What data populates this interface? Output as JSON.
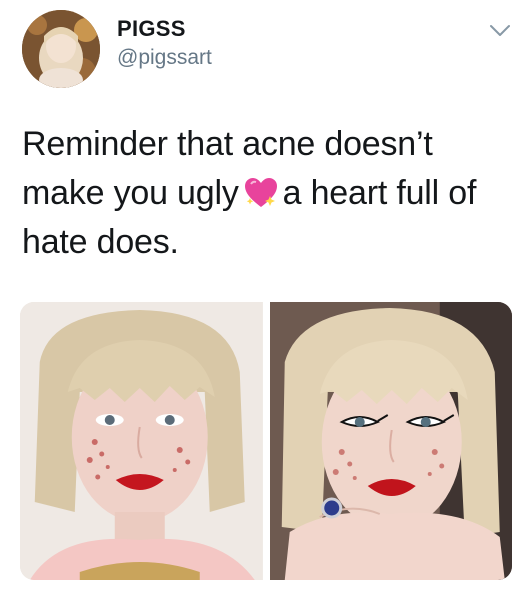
{
  "user": {
    "display_name": "PIGSS",
    "handle": "@pigssart"
  },
  "tweet": {
    "text_before_emoji": "Reminder that acne doesn’t make you ugly",
    "emoji": "sparkling-heart-emoji",
    "text_after_emoji": "a heart full of hate does."
  },
  "icons": {
    "menu": "chevron-down-icon"
  },
  "colors": {
    "text": "#14171a",
    "secondary_text": "#657786",
    "heart": "#e8439c"
  }
}
